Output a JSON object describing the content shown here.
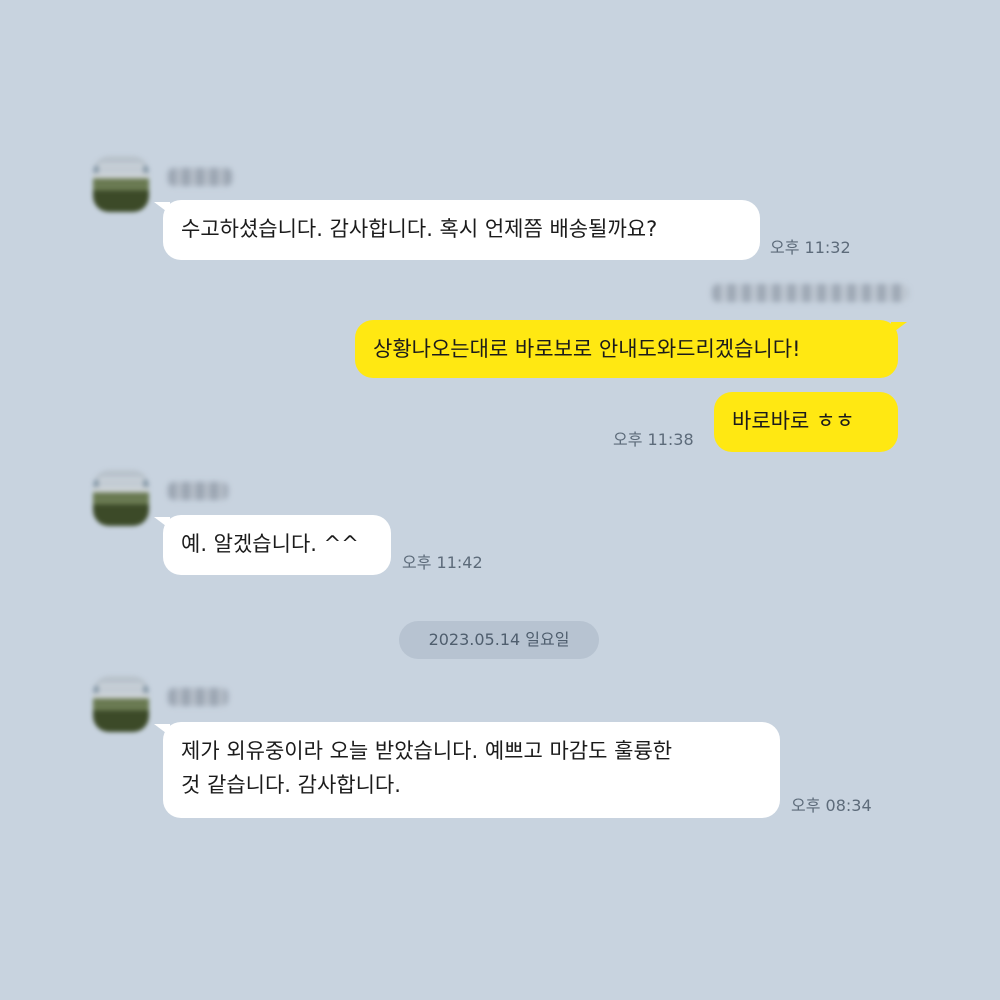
{
  "messages": [
    {
      "text": "수고하셨습니다. 감사합니다. 혹시 언제쯤 배송될까요?",
      "time": "오후 11:32"
    },
    {
      "text": "상황나오는대로 바로보로 안내도와드리겠습니다!"
    },
    {
      "text": "바로바로 ㅎㅎ",
      "time": "오후 11:38"
    },
    {
      "text": "예. 알겠습니다. ^^",
      "time": "오후 11:42"
    },
    {
      "line1": "제가 외유중이라 오늘 받았습니다. 예쁘고 마감도 훌륭한",
      "line2": "것 같습니다. 감사합니다.",
      "time": "오후 08:34"
    }
  ],
  "date_divider": "2023.05.14 일요일",
  "colors": {
    "background": "#c8d3df",
    "incoming_bubble": "#ffffff",
    "outgoing_bubble": "#ffe812",
    "date_pill": "#b7c3d1"
  }
}
